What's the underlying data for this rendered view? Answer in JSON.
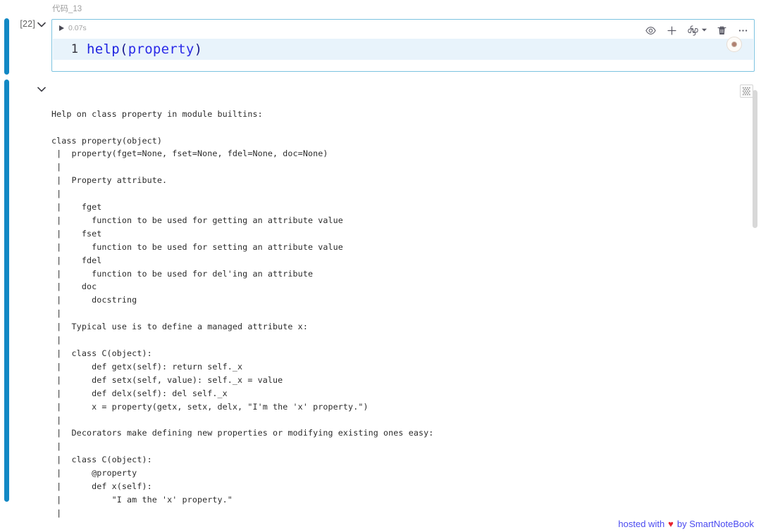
{
  "notebook": {
    "cell_type_label": "代码_13",
    "execution_count": "[22]",
    "chevron_code_icon": "chevron-down-icon",
    "chevron_output_icon": "chevron-down-icon"
  },
  "code_cell": {
    "run_icon": "play-triangle-icon",
    "run_time": "0.07s",
    "line_number": "1",
    "code_tokens": {
      "fn": "help",
      "open_paren": "(",
      "arg": "property",
      "close_paren": ")"
    },
    "toolbar": {
      "eye_icon": "eye-icon",
      "add_icon": "plus-icon",
      "kernel_icon": "python-logo-icon",
      "kernel_caret_icon": "caret-down-icon",
      "delete_icon": "trash-icon",
      "more_icon": "ellipsis-icon"
    },
    "kernel_badge": "kernel-status-icon"
  },
  "output": {
    "tool_icon": "output-options-icon",
    "scrollbar": "vertical-scrollbar",
    "text": "Help on class property in module builtins:\n\nclass property(object)\n |  property(fget=None, fset=None, fdel=None, doc=None)\n |  \n |  Property attribute.\n |  \n |    fget\n |      function to be used for getting an attribute value\n |    fset\n |      function to be used for setting an attribute value\n |    fdel\n |      function to be used for del'ing an attribute\n |    doc\n |      docstring\n |  \n |  Typical use is to define a managed attribute x:\n |  \n |  class C(object):\n |      def getx(self): return self._x\n |      def setx(self, value): self._x = value\n |      def delx(self): del self._x\n |      x = property(getx, setx, delx, \"I'm the 'x' property.\")\n |  \n |  Decorators make defining new properties or modifying existing ones easy:\n |  \n |  class C(object):\n |      @property\n |      def x(self):\n |          \"I am the 'x' property.\"\n |"
  },
  "footer": {
    "prefix": "hosted with",
    "heart": "♥",
    "suffix": "by SmartNoteBook"
  },
  "colors": {
    "cell_bar": "#1288c4",
    "cell_border": "#7cc3e0",
    "active_line": "#e8f3fb",
    "code_blue": "#1f23e0",
    "footer_link": "#4a4af0",
    "heart_red": "#e8222e"
  }
}
